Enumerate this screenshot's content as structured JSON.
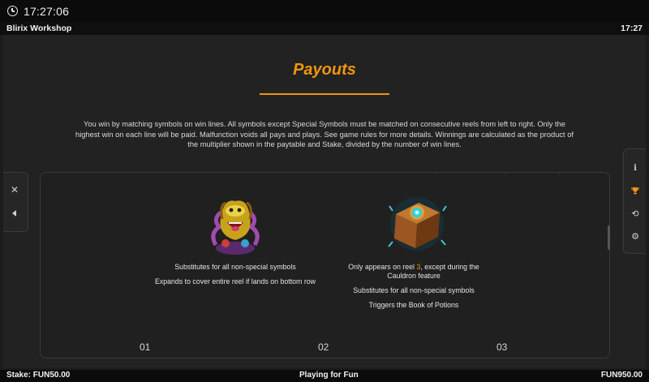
{
  "system_bar": {
    "time": "17:27:06",
    "clock_icon": "clock-icon"
  },
  "header": {
    "app_title": "Blirix Workshop",
    "time": "17:27"
  },
  "payouts": {
    "title": "Payouts",
    "accent_color": "#f0960e",
    "rules_text": "You win by matching symbols on win lines. All symbols except Special Symbols must be matched on consecutive reels from left to right. Only the highest win on each line will be paid. Malfunction voids all pays and plays. See game rules for more details. Winnings are calculated as the product of the multiplier shown in the paytable and Stake, divided by the number of win lines."
  },
  "side_left": {
    "buttons": [
      "close-icon",
      "back-arrow-icon"
    ]
  },
  "side_right": {
    "buttons": [
      "info-icon",
      "trophy-icon",
      "history-icon",
      "settings-icon"
    ]
  },
  "symbols": [
    {
      "icon": "wild-creature-icon",
      "lines": [
        "Substitutes for all non-special symbols",
        "Expands to cover entire reel if lands on bottom row"
      ]
    },
    {
      "icon": "book-of-potions-icon",
      "reel_prefix": "Only appears on reel ",
      "reel_number": "3",
      "reel_suffix": ", except during the",
      "lines": [
        "Cauldron feature",
        "Substitutes for all non-special symbols",
        "Triggers the Book of Potions"
      ]
    }
  ],
  "pagination": [
    "01",
    "02",
    "03"
  ],
  "status": {
    "stake": "Stake:  FUN50.00",
    "mode": "Playing for Fun",
    "balance": "FUN950.00"
  }
}
